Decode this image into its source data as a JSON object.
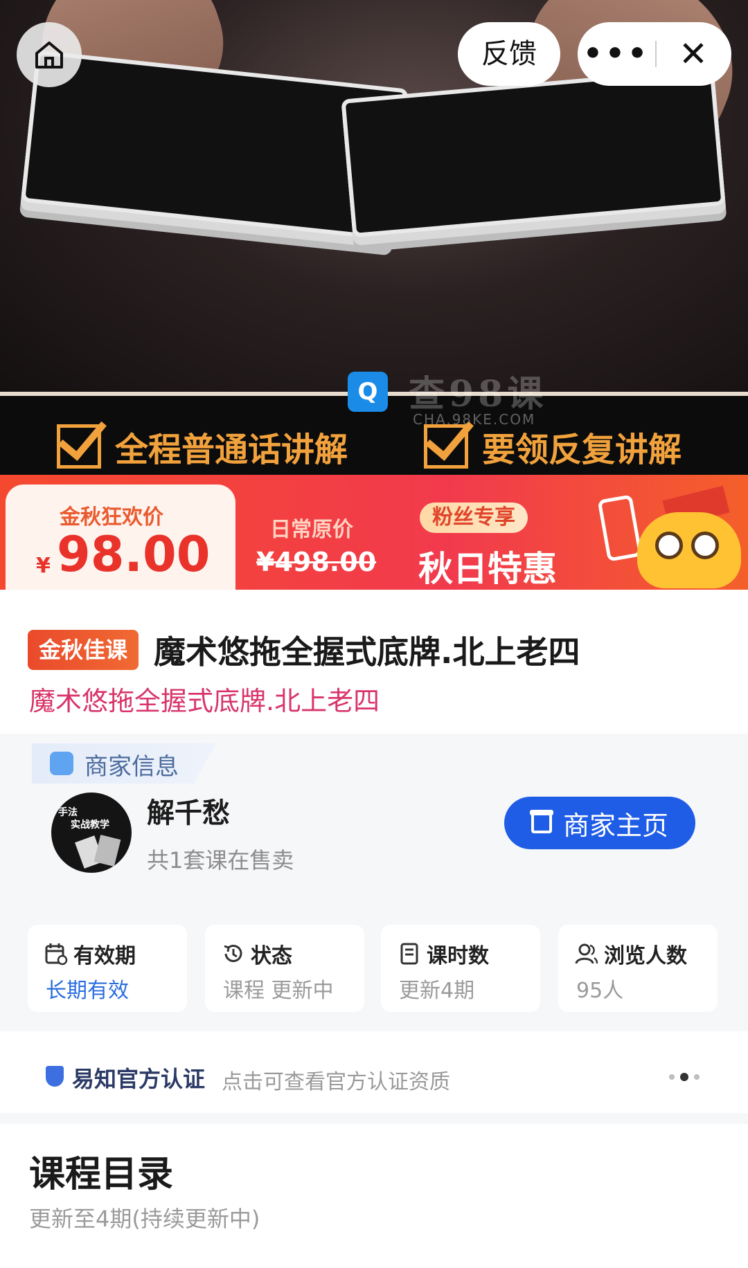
{
  "topbar": {
    "feedback_label": "反馈",
    "more_label": "•••",
    "close_label": "✕"
  },
  "banner": {
    "watermark_text": "查98课",
    "watermark_url": "CHA.98KE.COM",
    "features": [
      "全程普通话讲解",
      "要领反复讲解"
    ],
    "sale_price_label": "金秋狂欢价",
    "currency": "¥",
    "sale_price": "98.00",
    "original_price_label": "日常原价",
    "original_price": "¥498.00",
    "fans_badge": "粉丝专享",
    "promo_text": "秋日特惠"
  },
  "course": {
    "tag": "金秋佳课",
    "title": "魔术悠拖全握式底牌.北上老四",
    "subtitle": "魔术悠拖全握式底牌.北上老四"
  },
  "merchant": {
    "section_label": "商家信息",
    "avatar_text_1": "手法",
    "avatar_text_2": "实战教学",
    "name": "解千愁",
    "course_count": "共1套课在售卖",
    "home_button": "商家主页"
  },
  "stats": [
    {
      "label": "有效期",
      "value": "长期有效",
      "icon": "calendar-icon"
    },
    {
      "label": "状态",
      "value": "课程 更新中",
      "icon": "history-icon"
    },
    {
      "label": "课时数",
      "value": "更新4期",
      "icon": "document-icon"
    },
    {
      "label": "浏览人数",
      "value": "95人",
      "icon": "people-icon"
    }
  ],
  "certification": {
    "brand": "易知官方认证",
    "description": "点击可查看官方认证资质"
  },
  "catalog": {
    "title": "课程目录",
    "subtitle": "更新至4期(持续更新中)"
  },
  "colors": {
    "accent_blue": "#1f5de6",
    "price_red": "#e8322a",
    "subtitle_pink": "#d8356a"
  }
}
